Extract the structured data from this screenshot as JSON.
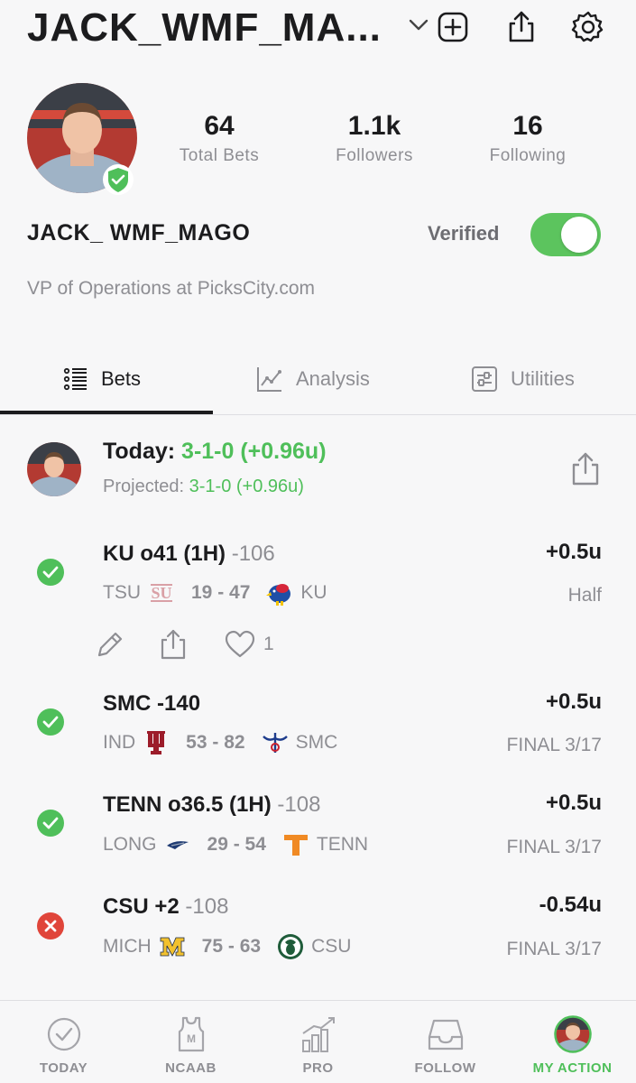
{
  "header": {
    "title": "JACK_WMF_MA...",
    "icons": [
      "chevron-down-icon",
      "add-square-icon",
      "share-icon",
      "settings-gear-icon"
    ]
  },
  "profile": {
    "stats": [
      {
        "value": "64",
        "label": "Total Bets"
      },
      {
        "value": "1.1k",
        "label": "Followers"
      },
      {
        "value": "16",
        "label": "Following"
      }
    ],
    "display_name": "JACK_ WMF_MAGO",
    "verified_label": "Verified",
    "verified_on": true,
    "bio": "VP of Operations at PicksCity.com"
  },
  "tabs": [
    {
      "label": "Bets",
      "icon": "list-icon",
      "active": true
    },
    {
      "label": "Analysis",
      "icon": "line-chart-icon",
      "active": false
    },
    {
      "label": "Utilities",
      "icon": "sliders-icon",
      "active": false
    }
  ],
  "summary": {
    "today_label": "Today:",
    "today_value": "3-1-0 (+0.96u)",
    "projected_label": "Projected:",
    "projected_value": "3-1-0 (+0.96u)"
  },
  "bets": [
    {
      "title": "KU o41 (1H)",
      "odds": "-106",
      "units": "+0.5u",
      "result": "win",
      "away": "TSU",
      "score": "19 - 47",
      "home": "KU",
      "status": "Half",
      "like_count": "1"
    },
    {
      "title": "SMC",
      "odds": "-140",
      "units": "+0.5u",
      "result": "win",
      "away": "IND",
      "score": "53 - 82",
      "home": "SMC",
      "status": "FINAL 3/17"
    },
    {
      "title": "TENN o36.5 (1H)",
      "odds": "-108",
      "units": "+0.5u",
      "result": "win",
      "away": "LONG",
      "score": "29 - 54",
      "home": "TENN",
      "status": "FINAL 3/17"
    },
    {
      "title": "CSU +2",
      "odds": "-108",
      "units": "-0.54u",
      "result": "loss",
      "away": "MICH",
      "score": "75 - 63",
      "home": "CSU",
      "status": "FINAL 3/17"
    }
  ],
  "bottom_nav": [
    {
      "label": "TODAY",
      "icon": "check-circle-icon",
      "active": false
    },
    {
      "label": "NCAAB",
      "icon": "jersey-icon",
      "active": false
    },
    {
      "label": "PRO",
      "icon": "bar-chart-icon",
      "active": false
    },
    {
      "label": "FOLLOW",
      "icon": "inbox-icon",
      "active": false
    },
    {
      "label": "MY ACTION",
      "icon": "avatar-icon",
      "active": true
    }
  ],
  "colors": {
    "accent_green": "#4fbf5a",
    "loss_red": "#e0453a",
    "toggle_green": "#5cc45e"
  }
}
